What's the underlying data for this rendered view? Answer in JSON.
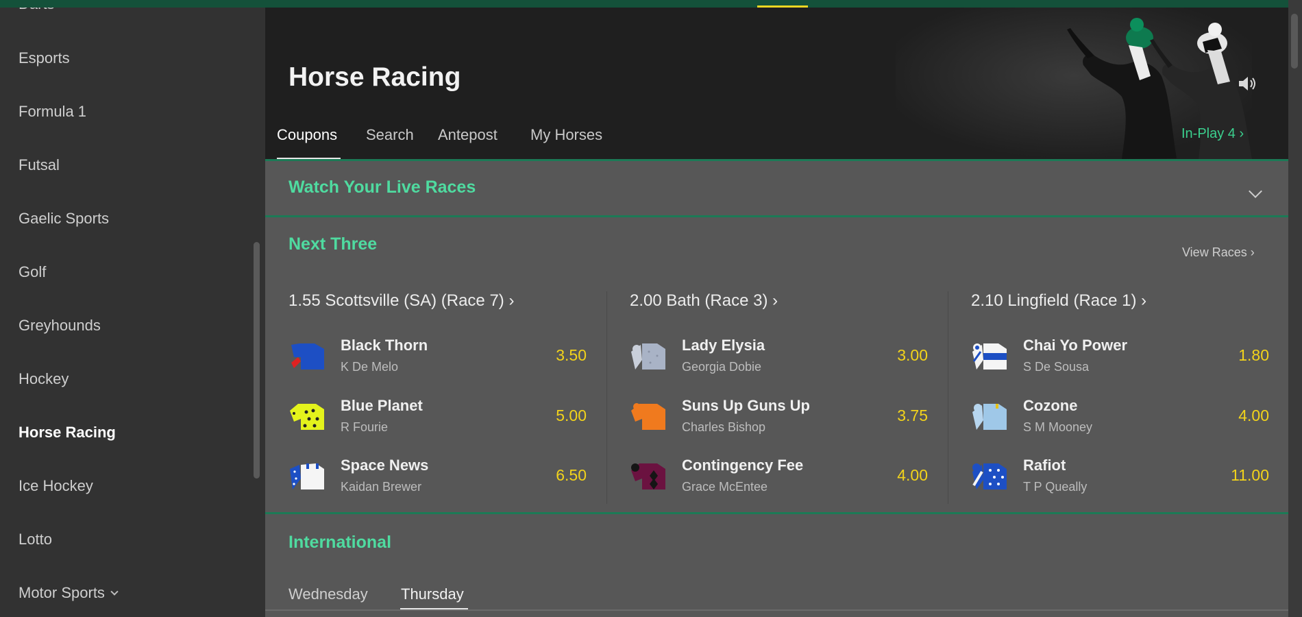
{
  "sidebar": {
    "items": [
      {
        "label": "Darts"
      },
      {
        "label": "Esports"
      },
      {
        "label": "Formula 1"
      },
      {
        "label": "Futsal"
      },
      {
        "label": "Gaelic Sports"
      },
      {
        "label": "Golf"
      },
      {
        "label": "Greyhounds"
      },
      {
        "label": "Hockey"
      },
      {
        "label": "Horse Racing",
        "active": true
      },
      {
        "label": "Ice Hockey"
      },
      {
        "label": "Lotto"
      },
      {
        "label": "Motor Sports"
      }
    ]
  },
  "header": {
    "title": "Horse Racing",
    "tabs": [
      {
        "label": "Coupons",
        "active": true
      },
      {
        "label": "Search"
      },
      {
        "label": "Antepost"
      },
      {
        "label": "My Horses"
      }
    ],
    "inplay_label": "In-Play 4"
  },
  "live": {
    "title": "Watch Your Live Races"
  },
  "next_three": {
    "title": "Next Three",
    "view_races_label": "View Races",
    "races": [
      {
        "title": "1.55 Scottsville (SA) (Race 7)",
        "runners": [
          {
            "name": "Black Thorn",
            "jockey": "K De Melo",
            "odds": "3.50"
          },
          {
            "name": "Blue Planet",
            "jockey": "R Fourie",
            "odds": "5.00"
          },
          {
            "name": "Space News",
            "jockey": "Kaidan Brewer",
            "odds": "6.50"
          }
        ]
      },
      {
        "title": "2.00 Bath (Race 3)",
        "runners": [
          {
            "name": "Lady Elysia",
            "jockey": "Georgia Dobie",
            "odds": "3.00"
          },
          {
            "name": "Suns Up Guns Up",
            "jockey": "Charles Bishop",
            "odds": "3.75"
          },
          {
            "name": "Contingency Fee",
            "jockey": "Grace McEntee",
            "odds": "4.00"
          }
        ]
      },
      {
        "title": "2.10 Lingfield (Race 1)",
        "runners": [
          {
            "name": "Chai Yo Power",
            "jockey": "S De Sousa",
            "odds": "1.80"
          },
          {
            "name": "Cozone",
            "jockey": "S M Mooney",
            "odds": "4.00"
          },
          {
            "name": "Rafiot",
            "jockey": "T P Queally",
            "odds": "11.00"
          }
        ]
      }
    ]
  },
  "international": {
    "title": "International",
    "days": [
      {
        "label": "Wednesday"
      },
      {
        "label": "Thursday",
        "active": true
      }
    ]
  },
  "colors": {
    "accent_green": "#4fdba0",
    "odds_yellow": "#f2d31b",
    "top_bar": "#14513a"
  }
}
